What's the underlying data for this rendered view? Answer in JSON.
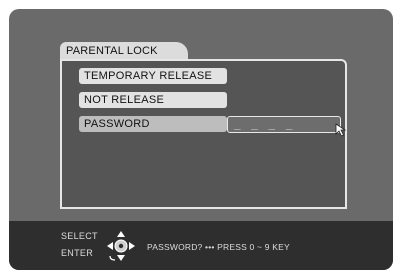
{
  "menu": {
    "tab_label": "PARENTAL LOCK",
    "items": [
      {
        "label": "TEMPORARY RELEASE"
      },
      {
        "label": "NOT RELEASE"
      },
      {
        "label": "PASSWORD"
      }
    ],
    "password_value": "_ _ _ _"
  },
  "footer": {
    "select_label": "SELECT",
    "enter_label": "ENTER",
    "hint": "PASSWORD? ••• PRESS 0 ~ 9 KEY"
  },
  "colors": {
    "screen_bg": "#6a6a6a",
    "panel_bg": "#555555",
    "item_bg": "#e2e2e2",
    "footer_bg": "#2e2e2e"
  }
}
